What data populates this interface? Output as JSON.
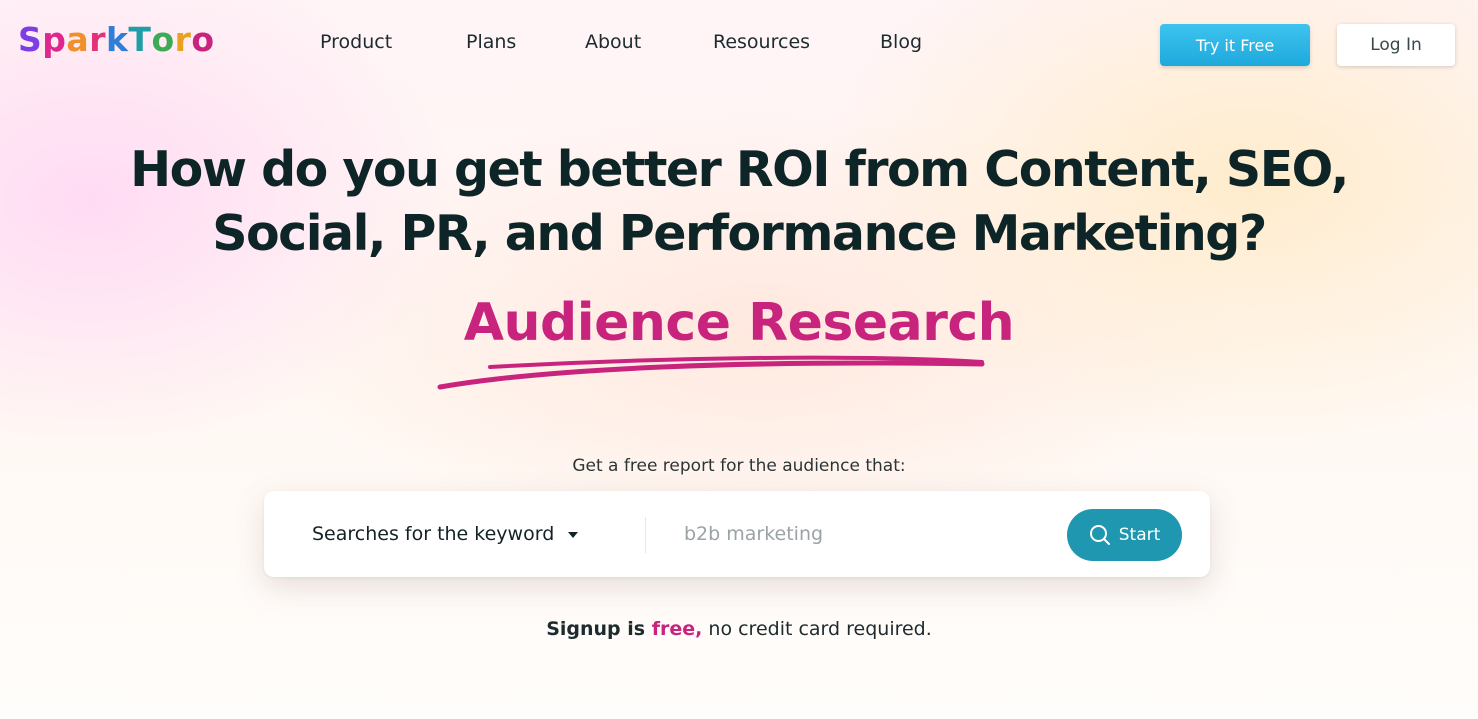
{
  "brand": {
    "logo_text": "SparkToro",
    "logo_letter_colors": [
      "#7b3fe4",
      "#e0268f",
      "#f0902a",
      "#e4307a",
      "#2f7fd8",
      "#1f9ea8",
      "#3daa55",
      "#e8a21f",
      "#c8247e"
    ]
  },
  "nav": {
    "links": [
      {
        "label": "Product"
      },
      {
        "label": "Plans"
      },
      {
        "label": "About"
      },
      {
        "label": "Resources"
      },
      {
        "label": "Blog"
      }
    ],
    "try_label": "Try it Free",
    "login_label": "Log In"
  },
  "hero": {
    "headline_line1": "How do you get better ROI from Content, SEO,",
    "headline_line2": "Social, PR, and Performance Marketing?",
    "highlight": "Audience Research"
  },
  "search": {
    "intro": "Get a free report for the audience that:",
    "dropdown_selected": "Searches for the keyword",
    "input_placeholder": "b2b marketing",
    "input_value": "",
    "start_label": "Start"
  },
  "signup": {
    "prefix": "Signup is ",
    "free_word": "free,",
    "suffix": " no credit card required."
  },
  "colors": {
    "accent_magenta": "#c8247e",
    "try_button": "#2ab4e4",
    "start_button": "#1f97b0",
    "headline": "#0e2528"
  },
  "icons": {
    "dropdown": "caret-down-icon",
    "start": "search-icon"
  }
}
